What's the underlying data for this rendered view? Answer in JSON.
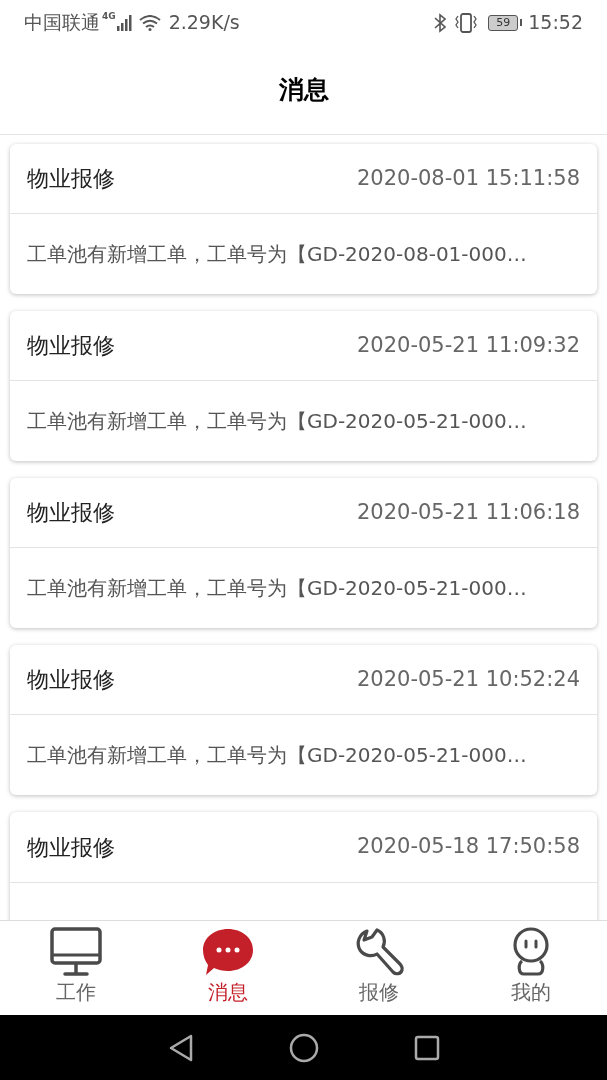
{
  "status_bar": {
    "carrier": "中国联通",
    "network": "4G",
    "speed": "2.29K/s",
    "battery": "59",
    "time": "15:52"
  },
  "header": {
    "title": "消息"
  },
  "messages": [
    {
      "category": "物业报修",
      "time": "2020-08-01 15:11:58",
      "body": "工单池有新增工单，工单号为【GD-2020-08-01-000…"
    },
    {
      "category": "物业报修",
      "time": "2020-05-21 11:09:32",
      "body": "工单池有新增工单，工单号为【GD-2020-05-21-000…"
    },
    {
      "category": "物业报修",
      "time": "2020-05-21 11:06:18",
      "body": "工单池有新增工单，工单号为【GD-2020-05-21-000…"
    },
    {
      "category": "物业报修",
      "time": "2020-05-21 10:52:24",
      "body": "工单池有新增工单，工单号为【GD-2020-05-21-000…"
    },
    {
      "category": "物业报修",
      "time": "2020-05-18 17:50:58"
    }
  ],
  "tab_bar": [
    {
      "kind": "monitor",
      "label": "工作",
      "selected": false
    },
    {
      "kind": "chat",
      "label": "消息",
      "selected": true
    },
    {
      "kind": "wrench",
      "label": "报修",
      "selected": false
    },
    {
      "kind": "person",
      "label": "我的",
      "selected": false
    }
  ]
}
